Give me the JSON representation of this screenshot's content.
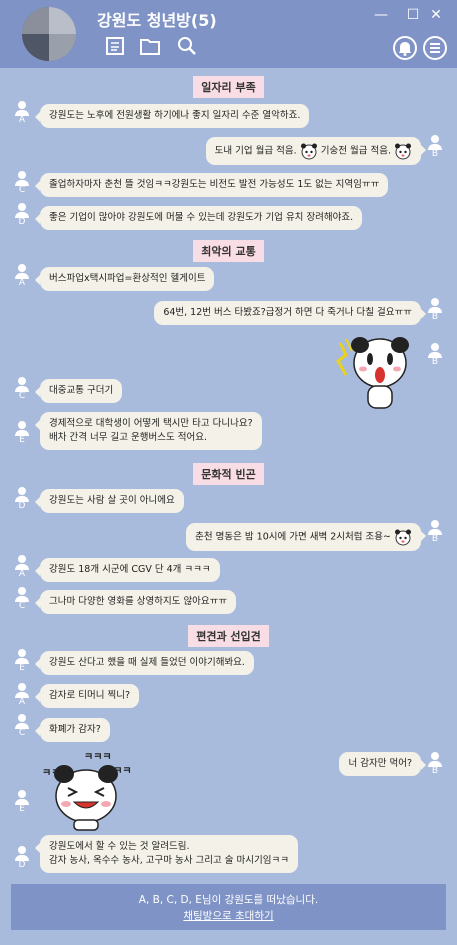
{
  "window": {
    "title": "강원도 청년방(5)",
    "controls": {
      "minimize": "—",
      "maximize": "☐",
      "close": "✕"
    }
  },
  "header_icons": [
    "notebook-icon",
    "folder-icon",
    "search-icon",
    "bell-icon",
    "menu-icon"
  ],
  "colors": {
    "header": "#7f93c6",
    "background": "#a9bbdd",
    "bubble": "#f4f2e8",
    "section_label": "#f9dde4"
  },
  "sections": [
    "일자리 부족",
    "최악의 교통",
    "문화적 빈곤",
    "편견과 선입견"
  ],
  "users": [
    "A",
    "B",
    "C",
    "D",
    "E"
  ],
  "messages": [
    {
      "user": "A",
      "side": "left",
      "text": "강원도는 노후에 전원생활 하기에나 좋지 일자리 수준 열악하죠."
    },
    {
      "user": "B",
      "side": "right",
      "text1": "도내 기업 월급 적음.",
      "text2": "기숭전 월급 적음."
    },
    {
      "user": "C",
      "side": "left",
      "text": "졸업하자마자 춘천 뜰 것임ㅋㅋ강원도는 비전도 발전 가능성도 1도 없는 지역임ㅠㅠ"
    },
    {
      "user": "D",
      "side": "left",
      "text": "좋은 기업이 많아야 강원도에 머물 수 있는데 강원도가 기업 유치 장려해야죠."
    },
    {
      "user": "A",
      "side": "left",
      "text": "버스파업x택시파업=환상적인 헬게이트"
    },
    {
      "user": "B",
      "side": "right",
      "text": "64번, 12번 버스 타봤죠?급정거 하면 다 죽거나 다칠 걸요ㅠㅠ"
    },
    {
      "user": "C",
      "side": "left",
      "text": "대중교통 구더기"
    },
    {
      "user": "E",
      "side": "left",
      "line1": "경제적으로 대학생이 어떻게 택시만 타고 다니나요?",
      "line2": "배차 간격 너무 길고 운행버스도 적어요."
    },
    {
      "user": "D",
      "side": "left",
      "text": "강원도는 사람 살 곳이 아니에요"
    },
    {
      "user": "B",
      "side": "right",
      "text": "춘천 명동은 밤 10시에 가면 새벽 2시처럼 조용~"
    },
    {
      "user": "A",
      "side": "left",
      "text": "강원도 18개 시군에 CGV 단 4개 ㅋㅋㅋ"
    },
    {
      "user": "C",
      "side": "left",
      "text": "그나마 다양한 영화를 상영하지도 않아요ㅠㅠ"
    },
    {
      "user": "E",
      "side": "left",
      "text": "강원도 산다고 했을 때 실제 들었던 이야기해봐요."
    },
    {
      "user": "A",
      "side": "left",
      "text": "감자로 티머니 찍니?"
    },
    {
      "user": "C",
      "side": "left",
      "text": "화폐가 감자?"
    },
    {
      "user": "B",
      "side": "right",
      "text": "너 감자만 먹어?"
    },
    {
      "user": "D",
      "side": "left",
      "line1": "강원도에서 할 수 있는 것 알려드림.",
      "line2": "감자 농사, 옥수수 농사, 고구마 농사 그리고 술 마시기임ㅋㅋ"
    }
  ],
  "stickers": {
    "shock": "shocked-panda-sticker",
    "laugh": "laughing-panda-sticker",
    "laugh_text": "ㅋㅋㅋ"
  },
  "footer": {
    "notice": "A, B, C, D, E님이 강원도를 떠났습니다.",
    "invite_link": "채팅방으로 초대하기"
  }
}
